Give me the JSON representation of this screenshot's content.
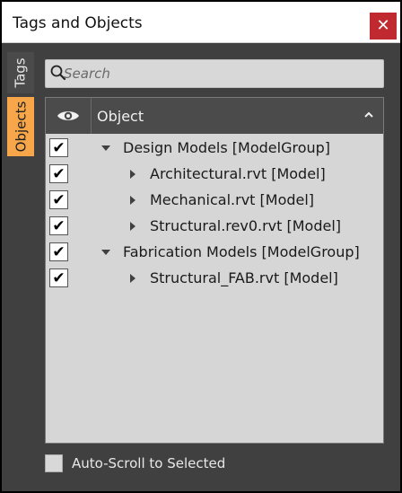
{
  "window": {
    "title": "Tags and Objects",
    "close_symbol": "✕"
  },
  "side_tabs": [
    {
      "label": "Tags",
      "active": false
    },
    {
      "label": "Objects",
      "active": true
    }
  ],
  "search": {
    "placeholder": "Search",
    "value": "",
    "icon": "search-icon"
  },
  "table": {
    "visibility_header_icon": "eye-icon",
    "column_header": "Object",
    "sort_icon": "chevron-up-icon",
    "rows": [
      {
        "label": "Design Models [ModelGroup]",
        "checked": true,
        "level": 0,
        "expanded": true
      },
      {
        "label": "Architectural.rvt [Model]",
        "checked": true,
        "level": 1,
        "expanded": false
      },
      {
        "label": "Mechanical.rvt [Model]",
        "checked": true,
        "level": 1,
        "expanded": false
      },
      {
        "label": "Structural.rev0.rvt [Model]",
        "checked": true,
        "level": 1,
        "expanded": false
      },
      {
        "label": "Fabrication Models [ModelGroup]",
        "checked": true,
        "level": 0,
        "expanded": true
      },
      {
        "label": "Structural_FAB.rvt [Model]",
        "checked": true,
        "level": 1,
        "expanded": false
      }
    ]
  },
  "auto_scroll": {
    "label": "Auto-Scroll to Selected",
    "checked": false
  },
  "colors": {
    "active_tab": "#f7a64a",
    "panel_bg": "#404040",
    "table_bg": "#d6d6d6",
    "close_button": "#c0292f"
  }
}
